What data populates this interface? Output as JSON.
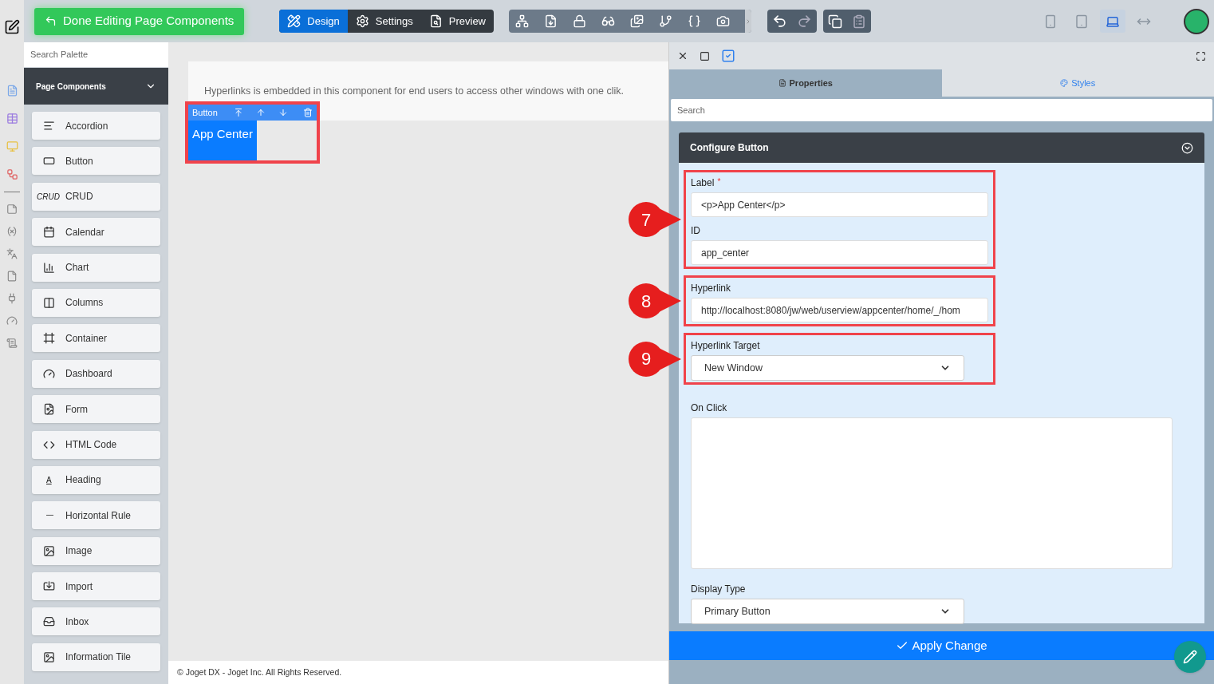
{
  "toolbar": {
    "done_button": "Done Editing Page Components",
    "modes": [
      {
        "kind": "design",
        "label": "Design",
        "selected": true
      },
      {
        "kind": "settings",
        "label": "Settings",
        "selected": false
      },
      {
        "kind": "preview",
        "label": "Preview",
        "selected": false
      }
    ],
    "devices": [
      {
        "kind": "phone",
        "selected": false
      },
      {
        "kind": "tablet",
        "selected": false
      },
      {
        "kind": "laptop",
        "selected": true
      },
      {
        "kind": "full",
        "selected": false
      }
    ]
  },
  "palette": {
    "search": {
      "placeholder": "Search Palette"
    },
    "section": "Page Components",
    "items": [
      {
        "kind": "accordion",
        "label": "Accordion"
      },
      {
        "kind": "button",
        "label": "Button"
      },
      {
        "kind": "crud",
        "label": "CRUD",
        "icon_text": "CRUD"
      },
      {
        "kind": "calendar",
        "label": "Calendar"
      },
      {
        "kind": "chart",
        "label": "Chart"
      },
      {
        "kind": "columns",
        "label": "Columns"
      },
      {
        "kind": "container",
        "label": "Container"
      },
      {
        "kind": "dashboard",
        "label": "Dashboard"
      },
      {
        "kind": "form",
        "label": "Form"
      },
      {
        "kind": "html",
        "label": "HTML Code"
      },
      {
        "kind": "heading",
        "label": "Heading",
        "icon_text": "A"
      },
      {
        "kind": "rule",
        "label": "Horizontal Rule"
      },
      {
        "kind": "image",
        "label": "Image"
      },
      {
        "kind": "import",
        "label": "Import"
      },
      {
        "kind": "inbox",
        "label": "Inbox"
      },
      {
        "kind": "tile",
        "label": "Information Tile"
      }
    ]
  },
  "canvas": {
    "description": "Hyperlinks is embedded in this component for end users to access other windows with one clik.",
    "component": {
      "type_label": "Button",
      "button_label": "App Center"
    },
    "footer": "© Joget DX - Joget Inc. All Rights Reserved."
  },
  "panel": {
    "tabs": [
      {
        "kind": "properties",
        "label": "Properties",
        "selected": true
      },
      {
        "kind": "styles",
        "label": "Styles",
        "selected": false
      }
    ],
    "search": {
      "placeholder": "Search"
    },
    "section": "Configure Button",
    "groups": [
      {
        "callout": "7",
        "fields": [
          {
            "kind": "text",
            "label": "Label",
            "required_mark": "*",
            "value": "<p>App Center</p>"
          },
          {
            "kind": "text",
            "label": "ID",
            "value": "app_center"
          }
        ]
      },
      {
        "callout": "8",
        "fields": [
          {
            "kind": "text",
            "label": "Hyperlink",
            "value": "http://localhost:8080/jw/web/userview/appcenter/home/_/hom"
          }
        ]
      },
      {
        "callout": "9",
        "fields": [
          {
            "kind": "select",
            "label": "Hyperlink Target",
            "value": "New Window"
          }
        ]
      },
      {
        "fields": [
          {
            "kind": "textarea",
            "label": "On Click"
          },
          {
            "kind": "select",
            "label": "Display Type",
            "value": "Primary Button"
          }
        ]
      }
    ],
    "apply_button": "Apply Change"
  }
}
